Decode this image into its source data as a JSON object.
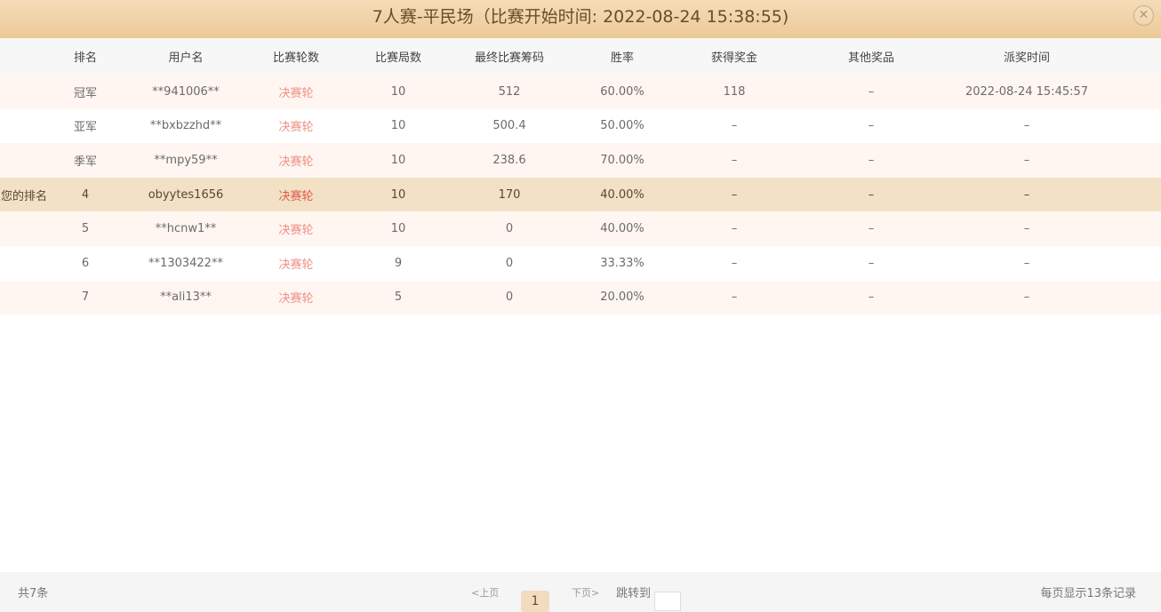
{
  "title": "7人赛-平民场（比赛开始时间: 2022-08-24 15:38:55)",
  "close_symbol": "✕",
  "columns": [
    "排名",
    "用户名",
    "比赛轮数",
    "比赛局数",
    "最终比赛筹码",
    "胜率",
    "获得奖金",
    "其他奖品",
    "派奖时间"
  ],
  "my_rank_label": "您的排名",
  "rows": [
    {
      "rank": "冠军",
      "user": "**941006**",
      "round": "决赛轮",
      "games": "10",
      "chips": "512",
      "winrate": "60.00%",
      "bonus": "118",
      "prize": "–",
      "time": "2022-08-24 15:45:57"
    },
    {
      "rank": "亚军",
      "user": "**bxbzzhd**",
      "round": "决赛轮",
      "games": "10",
      "chips": "500.4",
      "winrate": "50.00%",
      "bonus": "–",
      "prize": "–",
      "time": "–"
    },
    {
      "rank": "季军",
      "user": "**mpy59**",
      "round": "决赛轮",
      "games": "10",
      "chips": "238.6",
      "winrate": "70.00%",
      "bonus": "–",
      "prize": "–",
      "time": "–"
    },
    {
      "rank": "4",
      "user": "obyytes1656",
      "round": "决赛轮",
      "games": "10",
      "chips": "170",
      "winrate": "40.00%",
      "bonus": "–",
      "prize": "–",
      "time": "–"
    },
    {
      "rank": "5",
      "user": "**hcnw1**",
      "round": "决赛轮",
      "games": "10",
      "chips": "0",
      "winrate": "40.00%",
      "bonus": "–",
      "prize": "–",
      "time": "–"
    },
    {
      "rank": "6",
      "user": "**1303422**",
      "round": "决赛轮",
      "games": "9",
      "chips": "0",
      "winrate": "33.33%",
      "bonus": "–",
      "prize": "–",
      "time": "–"
    },
    {
      "rank": "7",
      "user": "**ali13**",
      "round": "决赛轮",
      "games": "5",
      "chips": "0",
      "winrate": "20.00%",
      "bonus": "–",
      "prize": "–",
      "time": "–"
    }
  ],
  "footer": {
    "total": "共7条",
    "prev": "<上页",
    "page": "1",
    "next": "下页>",
    "jump_label": "跳转到",
    "jump_value": "",
    "per_page": "每页显示13条记录"
  },
  "colors": {
    "title_bg": "#ecc999",
    "my_row_bg": "#f2e1c4",
    "odd_row_bg": "#fff6f1",
    "round_text": "#ef8f86"
  }
}
